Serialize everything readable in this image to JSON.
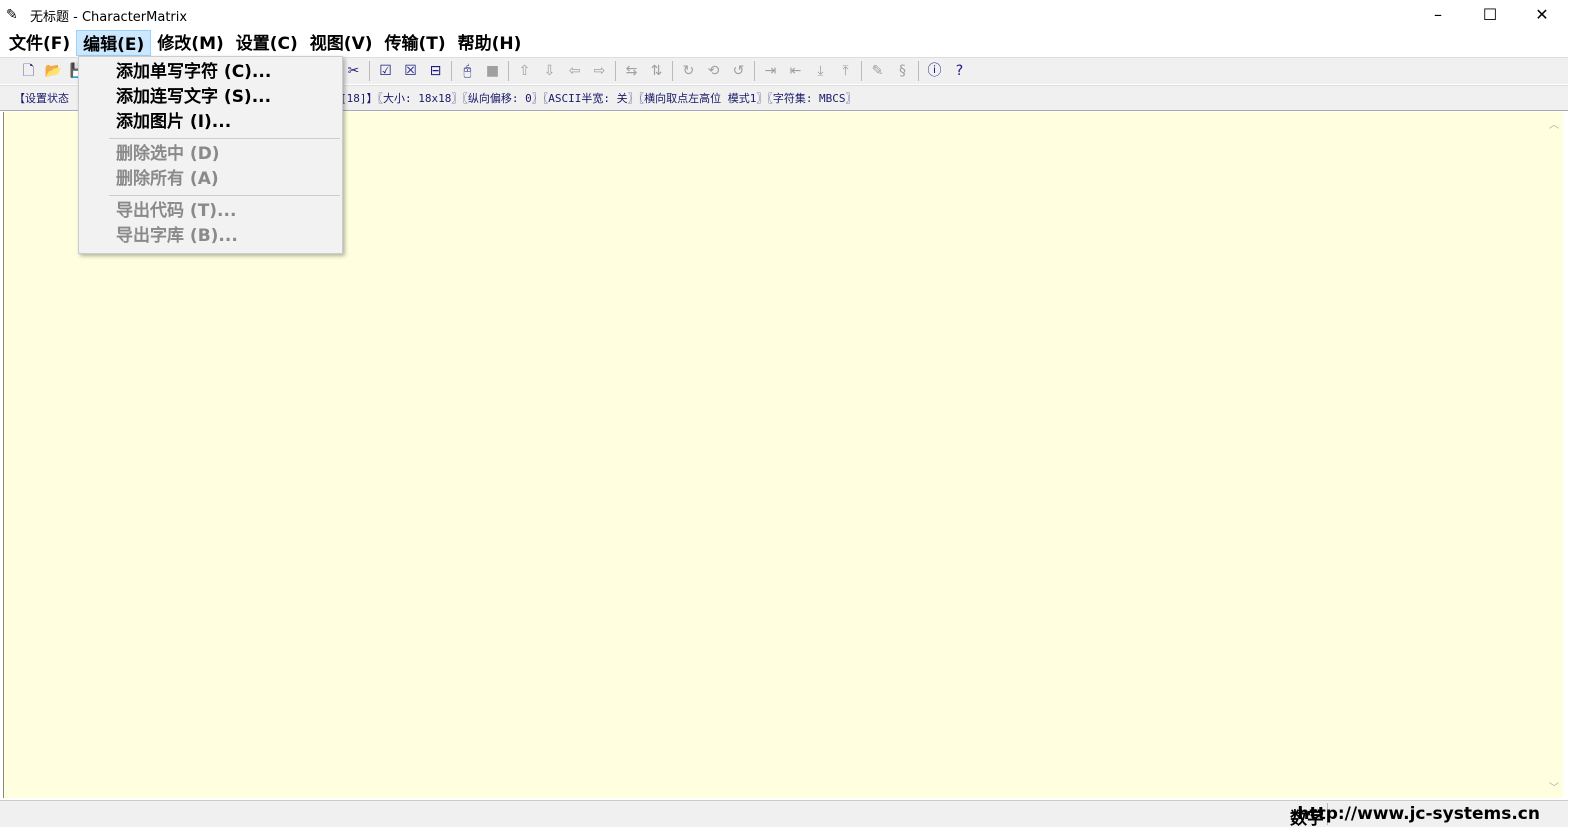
{
  "window": {
    "title": "无标题 - CharacterMatrix",
    "minimize": "–",
    "maximize": "☐",
    "close": "✕"
  },
  "menu": [
    "文件(F)",
    "编辑(E)",
    "修改(M)",
    "设置(C)",
    "视图(V)",
    "传输(T)",
    "帮助(H)"
  ],
  "toolbar": [
    {
      "icon": "new-file-icon",
      "glyph": "🗋",
      "enabled": true
    },
    {
      "icon": "open-folder-icon",
      "glyph": "📂",
      "enabled": true
    },
    {
      "icon": "save-icon",
      "glyph": "💾",
      "enabled": true
    },
    {
      "icon": "cut-icon",
      "glyph": "✂",
      "enabled": true
    },
    {
      "icon": "check-box-icon",
      "glyph": "☑",
      "enabled": true
    },
    {
      "icon": "cross-box-icon",
      "glyph": "☒",
      "enabled": true
    },
    {
      "icon": "half-box-icon",
      "glyph": "⊟",
      "enabled": true
    },
    {
      "icon": "mouse-icon",
      "glyph": "🖰",
      "enabled": true
    },
    {
      "icon": "stop-icon",
      "glyph": "■",
      "enabled": false
    },
    {
      "icon": "move-up-icon",
      "glyph": "⇧",
      "enabled": false
    },
    {
      "icon": "move-down-icon",
      "glyph": "⇩",
      "enabled": false
    },
    {
      "icon": "move-left-icon",
      "glyph": "⇦",
      "enabled": false
    },
    {
      "icon": "move-right-icon",
      "glyph": "⇨",
      "enabled": false
    },
    {
      "icon": "flip-horizontal-icon",
      "glyph": "⇆",
      "enabled": false
    },
    {
      "icon": "flip-vertical-icon",
      "glyph": "⇅",
      "enabled": false
    },
    {
      "icon": "rotate-cw-icon",
      "glyph": "↻",
      "enabled": false
    },
    {
      "icon": "mirror-icon",
      "glyph": "⟲",
      "enabled": false
    },
    {
      "icon": "rotate-ccw-icon",
      "glyph": "↺",
      "enabled": false
    },
    {
      "icon": "align-right-icon",
      "glyph": "⇥",
      "enabled": false
    },
    {
      "icon": "align-left-icon",
      "glyph": "⇤",
      "enabled": false
    },
    {
      "icon": "align-bottom-icon",
      "glyph": "⤓",
      "enabled": false
    },
    {
      "icon": "align-top-icon",
      "glyph": "⤒",
      "enabled": false
    },
    {
      "icon": "pen-icon",
      "glyph": "✎",
      "enabled": false
    },
    {
      "icon": "transfer-icon",
      "glyph": "§",
      "enabled": false
    },
    {
      "icon": "info-icon",
      "glyph": "ⓘ",
      "enabled": true
    },
    {
      "icon": "help-icon",
      "glyph": "?",
      "enabled": true
    }
  ],
  "infobar": {
    "left": "【设置状态",
    "right": "[18]】〖大小: 18x18〗〖纵向偏移: 0〗〖ASCII半宽: 关〗〖横向取点左高位 模式1〗〖字符集: MBCS〗"
  },
  "edit_menu": [
    {
      "label": "添加单写字符 (C)...",
      "enabled": true
    },
    {
      "label": "添加连写文字 (S)...",
      "enabled": true
    },
    {
      "label": "添加图片 (I)...",
      "enabled": true
    },
    {
      "sep": true
    },
    {
      "label": "删除选中 (D)",
      "enabled": false
    },
    {
      "label": "删除所有 (A)",
      "enabled": false
    },
    {
      "sep": true
    },
    {
      "label": "导出代码 (T)...",
      "enabled": false
    },
    {
      "label": "导出字库 (B)...",
      "enabled": false
    }
  ],
  "statusbar": {
    "mode": "数字",
    "url": "http://www.jc-systems.cn"
  }
}
